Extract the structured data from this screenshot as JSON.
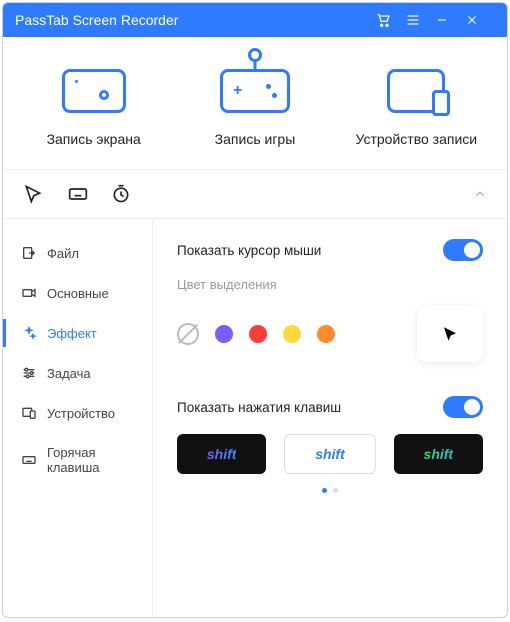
{
  "titlebar": {
    "title": "PassTab Screen Recorder"
  },
  "modes": [
    {
      "key": "screen",
      "label": "Запись экрана"
    },
    {
      "key": "game",
      "label": "Запись игры"
    },
    {
      "key": "device",
      "label": "Устройство записи"
    }
  ],
  "sidebar": {
    "items": [
      {
        "key": "file",
        "label": "Файл",
        "icon": "file-out-icon",
        "active": false
      },
      {
        "key": "basic",
        "label": "Основные",
        "icon": "camera-icon",
        "active": false
      },
      {
        "key": "effect",
        "label": "Эффект",
        "icon": "sparkle-icon",
        "active": true
      },
      {
        "key": "task",
        "label": "Задача",
        "icon": "sliders-icon",
        "active": false
      },
      {
        "key": "device",
        "label": "Устройство",
        "icon": "device-icon",
        "active": false
      },
      {
        "key": "hotkey",
        "label": "Горячая клавиша",
        "icon": "keyboard-icon",
        "active": false
      }
    ]
  },
  "panel": {
    "cursor": {
      "label": "Показать курсор мыши",
      "enabled": true,
      "color_label": "Цвет выделения",
      "colors": [
        "#7b5cff",
        "#ff3b3b",
        "#ffd83b",
        "#ff8a2e"
      ]
    },
    "keys": {
      "label": "Показать нажатия клавиш",
      "enabled": true,
      "sample": "shift",
      "active_style": 0
    }
  }
}
